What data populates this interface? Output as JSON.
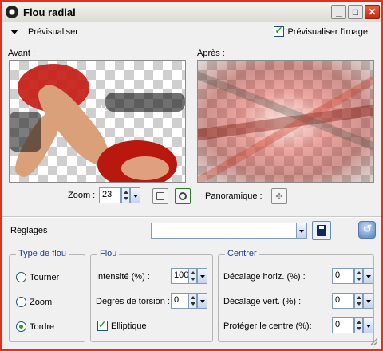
{
  "window": {
    "title": "Flou radial",
    "minimize_glyph": "_",
    "maximize_glyph": "□",
    "close_glyph": "✕"
  },
  "preview": {
    "toggle_label": "Prévisualiser",
    "preview_image_label": "Prévisualiser l'image",
    "preview_image_checked": true,
    "before_label": "Avant :",
    "after_label": "Après :",
    "zoom_label": "Zoom :",
    "zoom_value": "23",
    "pan_label": "Panoramique :",
    "pan_glyph": "✣"
  },
  "settings": {
    "label": "Réglages",
    "preset_value": ""
  },
  "blur_type": {
    "title": "Type de flou",
    "options": [
      {
        "label": "Tourner",
        "selected": false
      },
      {
        "label": "Zoom",
        "selected": false
      },
      {
        "label": "Tordre",
        "selected": true
      }
    ]
  },
  "blur": {
    "title": "Flou",
    "intensity_label": "Intensité (%) :",
    "intensity_value": "100",
    "torsion_label": "Degrés de torsion :",
    "torsion_value": "0",
    "elliptic_label": "Elliptique",
    "elliptic_checked": true
  },
  "center": {
    "title": "Centrer",
    "h_offset_label": "Décalage horiz. (%) :",
    "h_offset_value": "0",
    "v_offset_label": "Décalage vert. (%) :",
    "v_offset_value": "0",
    "protect_label": "Protéger le centre (%):",
    "protect_value": "0"
  },
  "colors": {
    "title_bar_border": "#e03020",
    "accent_green": "#21a121",
    "group_title": "#1a3f93"
  }
}
